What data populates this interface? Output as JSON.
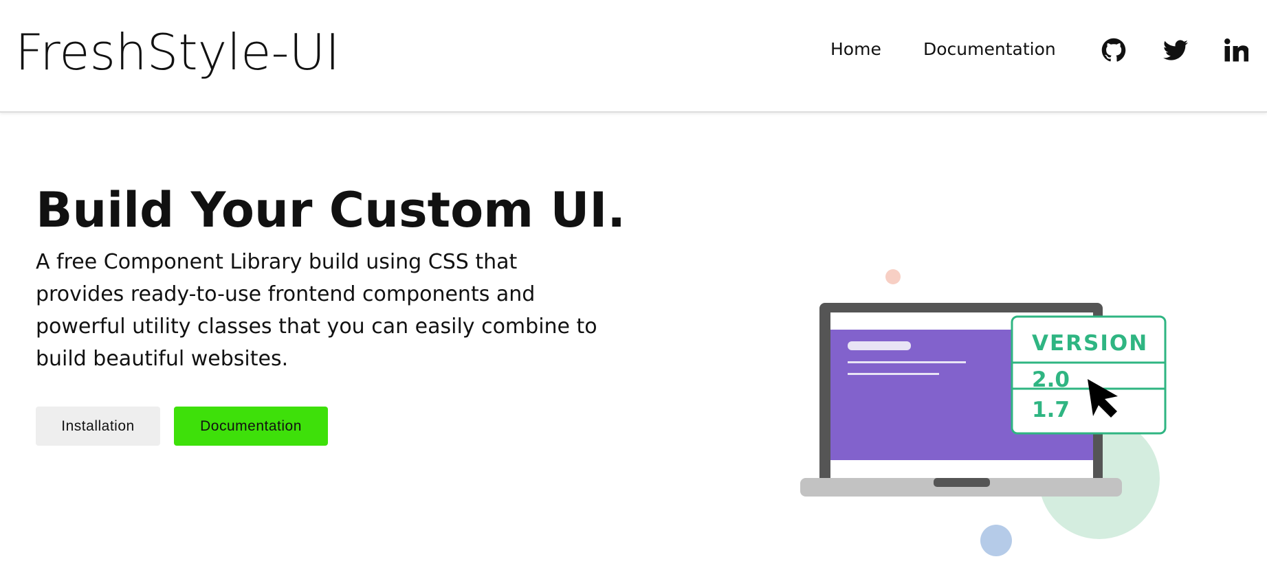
{
  "navbar": {
    "brand": "FreshStyle-UI",
    "links": [
      {
        "label": "Home"
      },
      {
        "label": "Documentation"
      }
    ],
    "social_icons": [
      "github-icon",
      "twitter-icon",
      "linkedin-icon"
    ]
  },
  "hero": {
    "title": "Build Your Custom UI.",
    "description": "A free Component Library build using CSS that provides ready-to-use frontend components and powerful utility classes that you can easily combine to build beautiful websites.",
    "buttons": {
      "installation": "Installation",
      "documentation": "Documentation"
    }
  },
  "illustration": {
    "version_card": {
      "header": "VERSION",
      "versions": [
        "2.0",
        "1.7"
      ]
    }
  },
  "colors": {
    "docs_button": "#3ee00a",
    "install_button": "#eeeeee",
    "screen_purple": "#8262cc",
    "version_green": "#2fb582",
    "laptop_frame": "#555555",
    "laptop_base": "#c2c2c2"
  }
}
